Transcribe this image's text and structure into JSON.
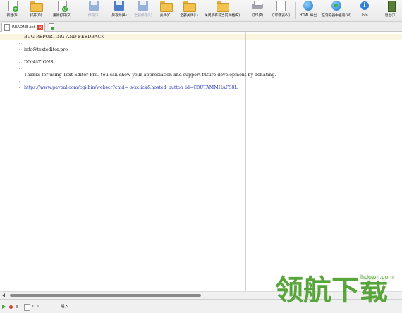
{
  "toolbar": {
    "buttons": [
      {
        "label": "新建(N)",
        "icon": "new-file-icon",
        "disabled": false
      },
      {
        "label": "打开(O)",
        "icon": "open-folder-icon",
        "disabled": false
      },
      {
        "label": "重新打开(R)",
        "icon": "reopen-icon",
        "disabled": false
      },
      {
        "label": "保存(S)",
        "icon": "save-icon",
        "disabled": true
      },
      {
        "label": "另存为(A)",
        "icon": "save-as-icon",
        "disabled": false
      },
      {
        "label": "全部保存(L)",
        "icon": "save-all-icon",
        "disabled": true
      },
      {
        "label": "关闭(C)",
        "icon": "close-file-icon",
        "disabled": false
      },
      {
        "label": "全部关闭(L)",
        "icon": "close-all-icon",
        "disabled": false
      },
      {
        "label": "关闭所有非当前文档(R)",
        "icon": "close-others-icon",
        "disabled": false
      },
      {
        "label": "打印(P)",
        "icon": "print-icon",
        "disabled": false
      },
      {
        "label": "打印预览(V)",
        "icon": "print-preview-icon",
        "disabled": false
      },
      {
        "label": "HTML 导出",
        "icon": "html-export-icon",
        "disabled": false
      },
      {
        "label": "在浏览器中查看(W)",
        "icon": "browser-icon",
        "disabled": false
      },
      {
        "label": "Info",
        "icon": "info-icon",
        "disabled": false
      },
      {
        "label": "退出(X)",
        "icon": "exit-icon",
        "disabled": false
      }
    ]
  },
  "tabs": [
    {
      "label": "README.txt",
      "active": true
    }
  ],
  "editor": {
    "lines": [
      "BUG REPORTING AND FEEDBACK",
      "",
      "info@texteditor.pro",
      "",
      "DONATIONS",
      "",
      "Thanks for using Text Editor Pro. You can show your appreciation and support future development by donating.",
      "",
      "https://www.paypal.com/cgi-bin/webscr?cmd=_s-xclick&hosted_button_id=C8UTAMMHAFS8L"
    ]
  },
  "status": {
    "position": "1: 1",
    "mode": "插入"
  },
  "watermark": {
    "text": "领航下载",
    "domain": "lhdown.com"
  },
  "colors": {
    "link": "#2d3fb8",
    "current_line": "#fbf6df",
    "watermark": "#58a53c"
  }
}
